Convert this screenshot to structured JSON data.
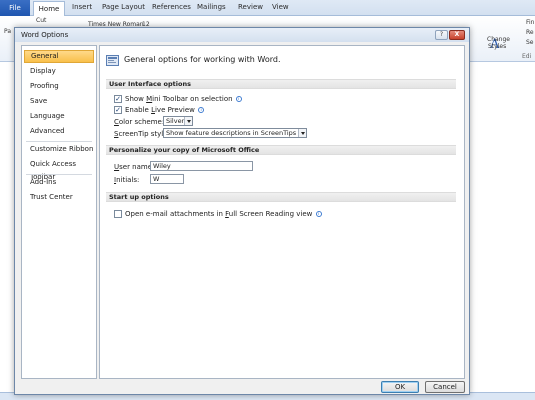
{
  "ribbon": {
    "tabs": [
      "File",
      "Home",
      "Insert",
      "Page Layout",
      "References",
      "Mailings",
      "Review",
      "View"
    ],
    "font_name": "Times New Roman",
    "font_size": "12",
    "clipboard_label": "Pa",
    "cut_label": "Cut",
    "change_styles_line1": "Change",
    "change_styles_line2": "Styles",
    "find_label": "Fin",
    "replace_label": "Re",
    "select_label": "Se",
    "editing_label": "Edi"
  },
  "dialog": {
    "title": "Word Options",
    "help_glyph": "?",
    "close_glyph": "X",
    "nav": [
      "General",
      "Display",
      "Proofing",
      "Save",
      "Language",
      "Advanced",
      "Customize Ribbon",
      "Quick Access Toolbar",
      "Add-Ins",
      "Trust Center"
    ],
    "active_nav": "General",
    "heading": "General options for working with Word.",
    "sections": {
      "ui": "User Interface options",
      "personalize": "Personalize your copy of Microsoft Office",
      "startup": "Start up options"
    },
    "options": {
      "mini_toolbar": {
        "label": "Show Mini Toolbar on selection",
        "checked": true
      },
      "live_preview": {
        "label": "Enable Live Preview",
        "checked": true
      },
      "color_scheme_label": "Color scheme:",
      "color_scheme_value": "Silver",
      "screentip_label": "ScreenTip style:",
      "screentip_value": "Show feature descriptions in ScreenTips",
      "user_name_label": "User name:",
      "user_name_value": "Wiley",
      "initials_label": "Initials:",
      "initials_value": "W",
      "fullscreen_reading": {
        "label": "Open e-mail attachments in Full Screen Reading view",
        "checked": false
      }
    },
    "buttons": {
      "ok": "OK",
      "cancel": "Cancel"
    }
  }
}
